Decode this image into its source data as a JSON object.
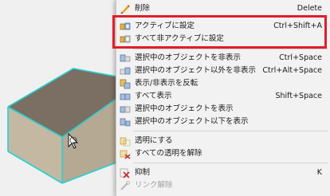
{
  "colors": {
    "viewport_bg": "#f0f0f0",
    "box_top": "#7a6f62",
    "box_side": "#b8ab96",
    "box_front": "#cfc3ad",
    "edge_highlight": "#25d0d0",
    "menu_bg": "#f2f2f2",
    "highlight_border": "#e01e2a"
  },
  "menu": {
    "items": [
      {
        "icon": "delete-icon",
        "label": "削除",
        "shortcut": "Delete"
      },
      {
        "icon": "activate-icon",
        "label": "アクティブに設定",
        "shortcut": "Ctrl+Shift+A"
      },
      {
        "icon": "deactivate-all-icon",
        "label": "すべて非アクティブに設定",
        "shortcut": ""
      },
      {
        "icon": "hide-selected-icon",
        "label": "選択中のオブジェクトを非表示",
        "shortcut": "Ctrl+Space"
      },
      {
        "icon": "hide-others-icon",
        "label": "選択中のオブジェクト以外を非表示",
        "shortcut": "Ctrl+Alt+Space"
      },
      {
        "icon": "toggle-visibility-icon",
        "label": "表示/非表示を反転",
        "shortcut": ""
      },
      {
        "icon": "show-all-icon",
        "label": "すべて表示",
        "shortcut": "Shift+Space"
      },
      {
        "icon": "show-selected-icon",
        "label": "選択中のオブジェクトを表示",
        "shortcut": ""
      },
      {
        "icon": "show-below-icon",
        "label": "選択中のオブジェクト以下を表示",
        "shortcut": ""
      },
      {
        "icon": "transparency-icon",
        "label": "透明にする",
        "shortcut": ""
      },
      {
        "icon": "clear-transparency-icon",
        "label": "すべての透明を解除",
        "shortcut": ""
      },
      {
        "icon": "suppress-icon",
        "label": "抑制",
        "shortcut": "K"
      },
      {
        "icon": "unlink-icon",
        "label": "リンク解除",
        "shortcut": ""
      }
    ]
  }
}
